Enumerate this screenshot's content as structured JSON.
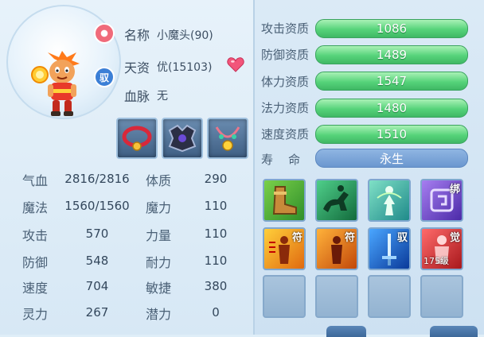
{
  "pet": {
    "name_label": "名称",
    "name_value": "小魔头(90)",
    "talent_label": "天资",
    "talent_value": "优(15103)",
    "bloodline_label": "血脉",
    "bloodline_value": "无",
    "bind_badge": "驭"
  },
  "icons": {
    "swirl": "swirl-icon",
    "heart": "heart-icon",
    "bind": "bind-badge-icon"
  },
  "equipment": [
    {
      "name": "red-collar-equip"
    },
    {
      "name": "dark-armor-equip"
    },
    {
      "name": "gem-necklace-equip"
    }
  ],
  "stats": [
    {
      "label": "气血",
      "value": "2816/2816"
    },
    {
      "label": "魔法",
      "value": "1560/1560"
    },
    {
      "label": "攻击",
      "value": "570"
    },
    {
      "label": "防御",
      "value": "548"
    },
    {
      "label": "速度",
      "value": "704"
    },
    {
      "label": "灵力",
      "value": "267"
    }
  ],
  "attributes": [
    {
      "label": "体质",
      "value": "290"
    },
    {
      "label": "魔力",
      "value": "110"
    },
    {
      "label": "力量",
      "value": "110"
    },
    {
      "label": "耐力",
      "value": "110"
    },
    {
      "label": "敏捷",
      "value": "380"
    },
    {
      "label": "潜力",
      "value": "0"
    }
  ],
  "aptitudes": [
    {
      "label": "攻击资质",
      "value": "1086"
    },
    {
      "label": "防御资质",
      "value": "1489"
    },
    {
      "label": "体力资质",
      "value": "1547"
    },
    {
      "label": "法力资质",
      "value": "1480"
    },
    {
      "label": "速度资质",
      "value": "1510"
    }
  ],
  "lifespan": {
    "label": "寿    命",
    "value": "永生"
  },
  "skills": [
    {
      "name": "boot-skill",
      "tag": "",
      "level": ""
    },
    {
      "name": "horse-rider-skill",
      "tag": "",
      "level": ""
    },
    {
      "name": "spirit-skill",
      "tag": "",
      "level": ""
    },
    {
      "name": "bind-rune-skill",
      "tag": "绑",
      "level": ""
    },
    {
      "name": "talisman-skill-1",
      "tag": "符",
      "level": ""
    },
    {
      "name": "talisman-skill-2",
      "tag": "符",
      "level": ""
    },
    {
      "name": "sword-skill",
      "tag": "驭",
      "level": ""
    },
    {
      "name": "awaken-skill",
      "tag": "觉",
      "level": "175级"
    }
  ],
  "colors": {
    "aptitude_bar": "#56d37a",
    "lifespan_bar": "#6b97cf",
    "panel_bg": "#dfeef8"
  }
}
